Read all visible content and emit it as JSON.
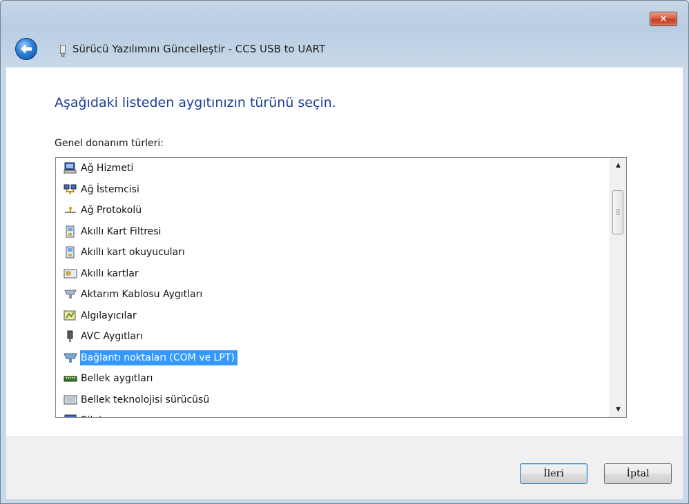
{
  "window": {
    "close_glyph": "✕",
    "title": "Sürücü Yazılımını Güncelleştir - CCS USB to UART"
  },
  "main": {
    "instruction": "Aşağıdaki listeden aygıtınızın türünü seçin.",
    "list_label": "Genel donanım türleri:",
    "items": [
      {
        "label": "Ağ Hizmeti",
        "icon": "network-service-icon"
      },
      {
        "label": "Ağ İstemcisi",
        "icon": "network-client-icon"
      },
      {
        "label": "Ağ Protokolü",
        "icon": "network-protocol-icon"
      },
      {
        "label": "Akıllı Kart Filtresi",
        "icon": "smart-card-filter-icon"
      },
      {
        "label": "Akıllı kart okuyucuları",
        "icon": "smart-card-reader-icon"
      },
      {
        "label": "Akıllı kartlar",
        "icon": "smart-card-icon"
      },
      {
        "label": "Aktarım Kablosu Aygıtları",
        "icon": "transfer-cable-icon"
      },
      {
        "label": "Algılayıcılar",
        "icon": "sensor-icon"
      },
      {
        "label": "AVC Aygıtları",
        "icon": "avc-device-icon"
      },
      {
        "label": "Bağlantı noktaları (COM ve LPT)",
        "icon": "port-icon",
        "selected": true
      },
      {
        "label": "Bellek aygıtları",
        "icon": "memory-device-icon"
      },
      {
        "label": "Bellek teknolojisi sürücüsü",
        "icon": "memory-technology-icon"
      },
      {
        "label": "Bilgisayar",
        "icon": "computer-icon"
      }
    ]
  },
  "footer": {
    "next_label": "İleri",
    "cancel_label": "İptal"
  },
  "colors": {
    "selection": "#3399ff",
    "instruction_text": "#1c3d9a"
  }
}
